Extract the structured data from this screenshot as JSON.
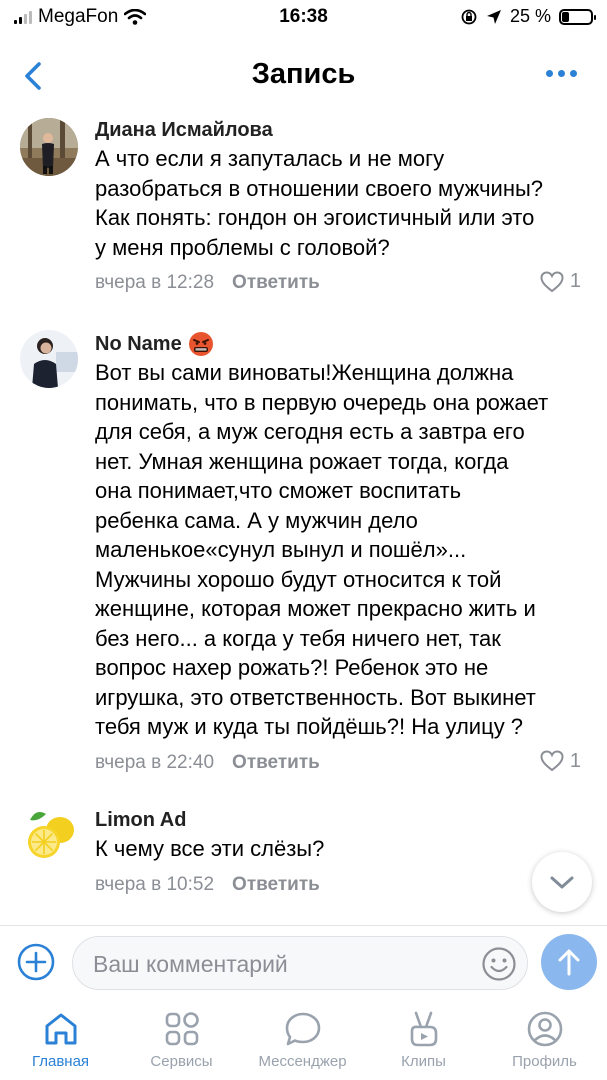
{
  "status": {
    "carrier": "MegaFon",
    "time": "16:38",
    "battery": "25 %",
    "battery_level": 0.25
  },
  "header": {
    "title": "Запись"
  },
  "comments": [
    {
      "author": "Диана Исмайлова",
      "text": "А что если я запуталась и не могу\nразобраться в отношении своего мужчины?\nКак понять: гондон он эгоистичный или это\nу меня проблемы с головой?",
      "time": "вчера в 12:28",
      "reply": "Ответить",
      "likes": "1"
    },
    {
      "author": "No Name",
      "author_emoji": "angry-face-emoji",
      "text": "Вот вы сами виноваты!Женщина должна\nпонимать, что в первую очередь она рожает\nдля себя, а муж сегодня есть а завтра его\nнет. Умная женщина рожает тогда, когда\nона понимает,что сможет воспитать\nребенка сама. А у мужчин дело\nмаленькое«сунул вынул и пошёл»...\nМужчины хорошо будут относится к той\nженщине, которая может прекрасно жить и\nбез него... а когда у тебя ничего нет, так\nвопрос нахер рожать?! Ребенок это не\nигрушка, это ответственность. Вот выкинет\nтебя муж и куда ты пойдёшь?! На улицу ?",
      "time": "вчера в 22:40",
      "reply": "Ответить",
      "likes": "1"
    },
    {
      "author": "Limon Ad",
      "text": "К чему все эти слёзы?",
      "time": "вчера в 10:52",
      "reply": "Ответить"
    }
  ],
  "composer": {
    "placeholder": "Ваш комментарий"
  },
  "tabs": [
    {
      "label": "Главная",
      "icon": "home-icon",
      "active": true
    },
    {
      "label": "Сервисы",
      "icon": "services-icon"
    },
    {
      "label": "Мессенджер",
      "icon": "messenger-icon"
    },
    {
      "label": "Клипы",
      "icon": "clips-icon"
    },
    {
      "label": "Профиль",
      "icon": "profile-icon"
    }
  ],
  "colors": {
    "accent": "#2a81d6",
    "muted": "#8b8f95",
    "send": "#8ab8ee"
  }
}
